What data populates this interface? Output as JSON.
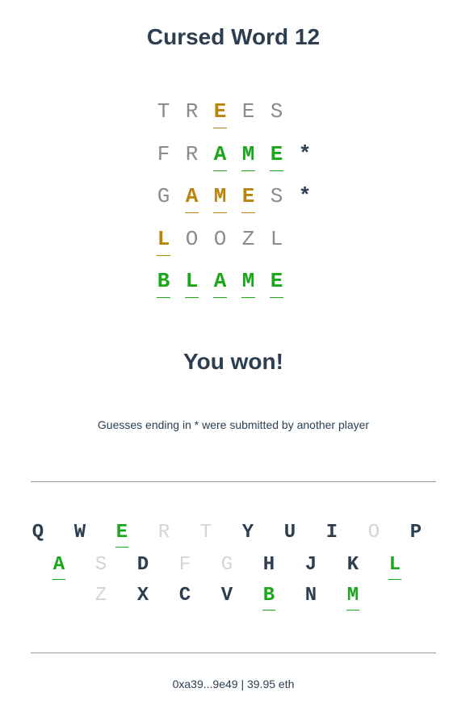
{
  "title": "Cursed Word 12",
  "guesses": [
    {
      "letters": [
        {
          "ch": "T",
          "state": "absent"
        },
        {
          "ch": "R",
          "state": "absent"
        },
        {
          "ch": "E",
          "state": "present"
        },
        {
          "ch": "E",
          "state": "absent"
        },
        {
          "ch": "S",
          "state": "absent"
        }
      ],
      "marker": ""
    },
    {
      "letters": [
        {
          "ch": "F",
          "state": "absent"
        },
        {
          "ch": "R",
          "state": "absent"
        },
        {
          "ch": "A",
          "state": "correct"
        },
        {
          "ch": "M",
          "state": "correct"
        },
        {
          "ch": "E",
          "state": "correct"
        }
      ],
      "marker": "*"
    },
    {
      "letters": [
        {
          "ch": "G",
          "state": "absent"
        },
        {
          "ch": "A",
          "state": "present"
        },
        {
          "ch": "M",
          "state": "present"
        },
        {
          "ch": "E",
          "state": "present"
        },
        {
          "ch": "S",
          "state": "absent"
        }
      ],
      "marker": "*"
    },
    {
      "letters": [
        {
          "ch": "L",
          "state": "present"
        },
        {
          "ch": "O",
          "state": "absent"
        },
        {
          "ch": "O",
          "state": "absent"
        },
        {
          "ch": "Z",
          "state": "absent"
        },
        {
          "ch": "L",
          "state": "absent"
        }
      ],
      "marker": ""
    },
    {
      "letters": [
        {
          "ch": "B",
          "state": "correct"
        },
        {
          "ch": "L",
          "state": "correct"
        },
        {
          "ch": "A",
          "state": "correct"
        },
        {
          "ch": "M",
          "state": "correct"
        },
        {
          "ch": "E",
          "state": "correct"
        }
      ],
      "marker": ""
    }
  ],
  "result_text": "You won!",
  "note": "Guesses ending in * were submitted by another player",
  "keyboard": [
    [
      {
        "ch": "Q",
        "state": "unused"
      },
      {
        "ch": "W",
        "state": "unused"
      },
      {
        "ch": "E",
        "state": "correct"
      },
      {
        "ch": "R",
        "state": "absent"
      },
      {
        "ch": "T",
        "state": "absent"
      },
      {
        "ch": "Y",
        "state": "unused"
      },
      {
        "ch": "U",
        "state": "unused"
      },
      {
        "ch": "I",
        "state": "unused"
      },
      {
        "ch": "O",
        "state": "absent"
      },
      {
        "ch": "P",
        "state": "unused"
      }
    ],
    [
      {
        "ch": "A",
        "state": "correct"
      },
      {
        "ch": "S",
        "state": "absent"
      },
      {
        "ch": "D",
        "state": "unused"
      },
      {
        "ch": "F",
        "state": "absent"
      },
      {
        "ch": "G",
        "state": "absent"
      },
      {
        "ch": "H",
        "state": "unused"
      },
      {
        "ch": "J",
        "state": "unused"
      },
      {
        "ch": "K",
        "state": "unused"
      },
      {
        "ch": "L",
        "state": "correct"
      }
    ],
    [
      {
        "ch": "Z",
        "state": "absent"
      },
      {
        "ch": "X",
        "state": "unused"
      },
      {
        "ch": "C",
        "state": "unused"
      },
      {
        "ch": "V",
        "state": "unused"
      },
      {
        "ch": "B",
        "state": "correct"
      },
      {
        "ch": "N",
        "state": "unused"
      },
      {
        "ch": "M",
        "state": "correct"
      }
    ]
  ],
  "footer": "0xa39...9e49 | 39.95 eth",
  "colors": {
    "text": "#2c3e50",
    "correct": "#1aa81a",
    "present": "#b8860b",
    "absent_board": "#8c8c8c",
    "absent_key": "#d4d4d4"
  }
}
